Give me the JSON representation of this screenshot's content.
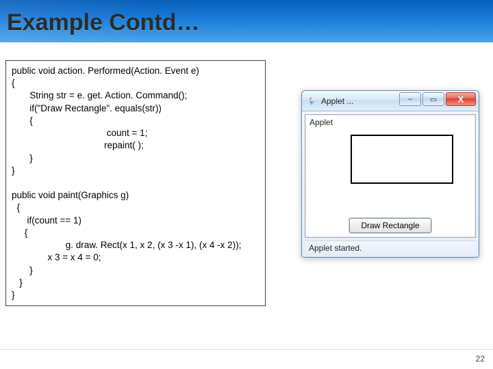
{
  "slide": {
    "title": "Example Contd…",
    "page_number": "22"
  },
  "code": {
    "line1": "public void action. Performed(Action. Event e)",
    "line2": "{",
    "line3": "       String str = e. get. Action. Command();",
    "line4": "       if(\"Draw Rectangle\". equals(str))",
    "line5": "       {",
    "line6": "                                     count = 1;",
    "line7": "                                    repaint( );",
    "line8": "       }",
    "line9": "}",
    "line10": "",
    "line11": "public void paint(Graphics g)",
    "line12": "  {",
    "line13": "      if(count == 1)",
    "line14": "     {",
    "line15": "                     g. draw. Rect(x 1, x 2, (x 3 -x 1), (x 4 -x 2));",
    "line16": "              x 3 = x 4 = 0;",
    "line17": "       }",
    "line18": "   }",
    "line19": "}"
  },
  "applet": {
    "window_title": "Applet ...",
    "inner_label": "Applet",
    "button_label": "Draw Rectangle",
    "status_text": "Applet started.",
    "icons": {
      "minimize": "–",
      "maximize": "▭",
      "close": "X"
    }
  }
}
